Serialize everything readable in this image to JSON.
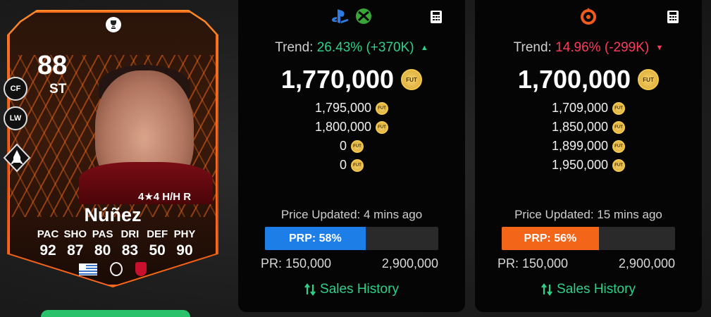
{
  "card": {
    "rating": "88",
    "position": "ST",
    "alt_positions": [
      "CF",
      "LW"
    ],
    "skill_line": "4★4 H/H R",
    "name": "Núñez",
    "stats": {
      "labels": [
        "PAC",
        "SHO",
        "PAS",
        "DRI",
        "DEF",
        "PHY"
      ],
      "values": [
        "92",
        "87",
        "80",
        "83",
        "50",
        "90"
      ]
    },
    "accent_color": "#ff6a1a"
  },
  "panels": {
    "left": {
      "platform_icons": [
        "playstation-icon",
        "xbox-icon"
      ],
      "trend_label": "Trend:",
      "trend_value": "26.43% (+370K)",
      "trend_direction": "up",
      "trend_arrow": "▲",
      "main_price": "1,770,000",
      "listings": [
        "1,795,000",
        "1,800,000",
        "0",
        "0"
      ],
      "updated": "Price Updated: 4 mins ago",
      "prp_label": "PRP: 58%",
      "prp_percent": 58,
      "pr_min": "PR: 150,000",
      "pr_max": "2,900,000",
      "sales_label": "Sales History",
      "bar_color": "#1e7ee8"
    },
    "right": {
      "platform_icons": [
        "origin-icon"
      ],
      "trend_label": "Trend:",
      "trend_value": "14.96% (-299K)",
      "trend_direction": "down",
      "trend_arrow": "▼",
      "main_price": "1,700,000",
      "listings": [
        "1,709,000",
        "1,850,000",
        "1,899,000",
        "1,950,000"
      ],
      "updated": "Price Updated: 15 mins ago",
      "prp_label": "PRP: 56%",
      "prp_percent": 56,
      "pr_min": "PR: 150,000",
      "pr_max": "2,900,000",
      "sales_label": "Sales History",
      "bar_color": "#f3661a"
    }
  },
  "coin_label": "FUT"
}
